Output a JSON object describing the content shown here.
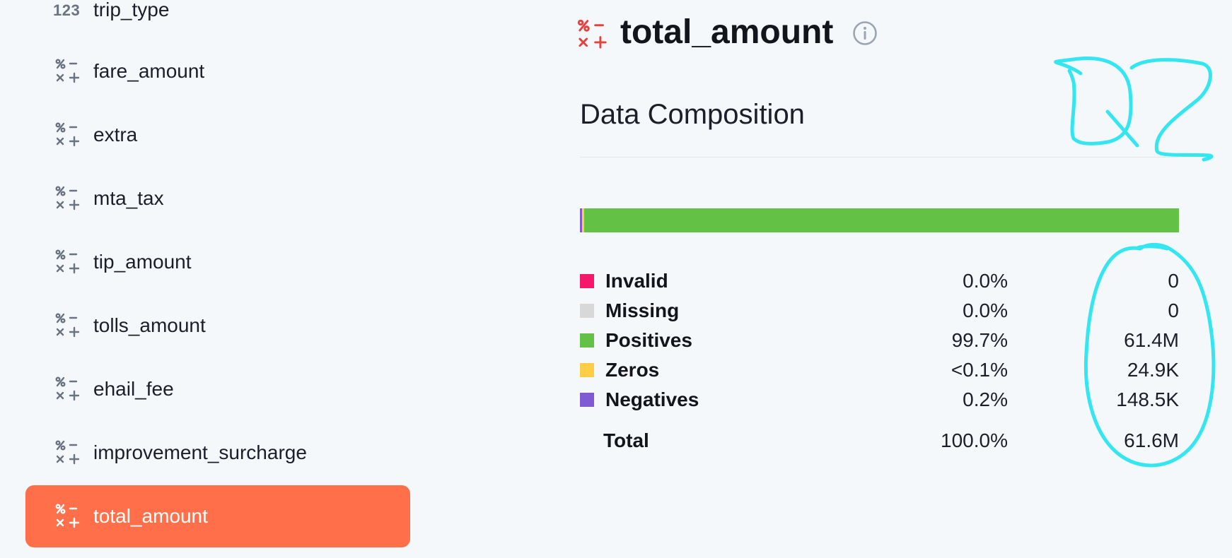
{
  "sidebar": {
    "items": [
      {
        "label": "trip_type",
        "type": "integer",
        "icon": "integer-123-icon"
      },
      {
        "label": "fare_amount",
        "type": "numeric",
        "icon": "numeric-operators-icon"
      },
      {
        "label": "extra",
        "type": "numeric",
        "icon": "numeric-operators-icon"
      },
      {
        "label": "mta_tax",
        "type": "numeric",
        "icon": "numeric-operators-icon"
      },
      {
        "label": "tip_amount",
        "type": "numeric",
        "icon": "numeric-operators-icon"
      },
      {
        "label": "tolls_amount",
        "type": "numeric",
        "icon": "numeric-operators-icon"
      },
      {
        "label": "ehail_fee",
        "type": "numeric",
        "icon": "numeric-operators-icon"
      },
      {
        "label": "improvement_surcharge",
        "type": "numeric",
        "icon": "numeric-operators-icon"
      },
      {
        "label": "total_amount",
        "type": "numeric",
        "icon": "numeric-operators-icon",
        "selected": true
      }
    ],
    "integer_icon_text": "123"
  },
  "main": {
    "column_title": "total_amount",
    "section_title": "Data Composition"
  },
  "composition": {
    "rows": [
      {
        "name": "Invalid",
        "percent": "0.0%",
        "count": "0",
        "color": "#f5186a",
        "fraction": 0.0
      },
      {
        "name": "Missing",
        "percent": "0.0%",
        "count": "0",
        "color": "#d8d8d8",
        "fraction": 0.0
      },
      {
        "name": "Positives",
        "percent": "99.7%",
        "count": "61.4M",
        "color": "#63c246",
        "fraction": 0.997
      },
      {
        "name": "Zeros",
        "percent": "<0.1%",
        "count": "24.9K",
        "color": "#fdcd48",
        "fraction": 0.0004
      },
      {
        "name": "Negatives",
        "percent": "0.2%",
        "count": "148.5K",
        "color": "#8059d4",
        "fraction": 0.0024
      }
    ],
    "total": {
      "name": "Total",
      "percent": "100.0%",
      "count": "61.6M"
    }
  },
  "annotation": {
    "text": "Q2",
    "color": "#33e6f0"
  },
  "colors": {
    "accent": "#fe6f4a",
    "icon_red": "#e8403d",
    "icon_gray": "#6a7380",
    "background": "#f5f8fb"
  }
}
